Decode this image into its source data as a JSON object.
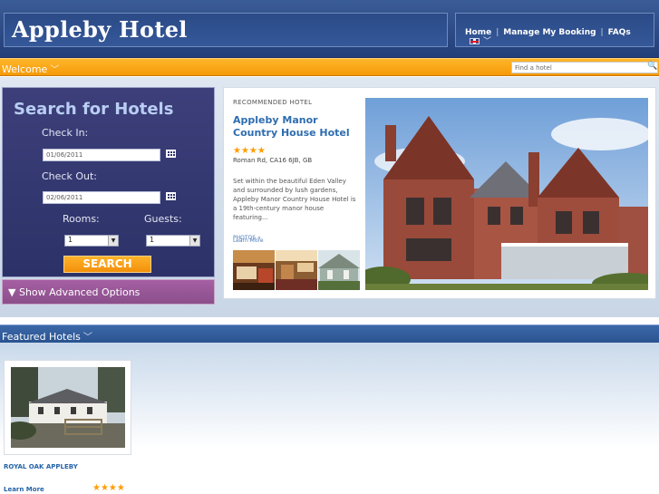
{
  "site": {
    "title": "Appleby Hotel"
  },
  "nav": {
    "links": [
      "Home",
      "Manage My Booking",
      "FAQs"
    ],
    "separator": "|",
    "language_icon": "uk-flag-icon"
  },
  "welcome": {
    "label": "Welcome",
    "find_placeholder": "Find a hotel"
  },
  "search": {
    "title": "Search for Hotels",
    "checkin_label": "Check In:",
    "checkin_value": "01/06/2011",
    "checkout_label": "Check Out:",
    "checkout_value": "02/06/2011",
    "rooms_label": "Rooms:",
    "guests_label": "Guests:",
    "rooms_value": "1",
    "guests_value": "1",
    "button_label": "SEARCH",
    "advanced_label": "▼ Show Advanced Options"
  },
  "recommended": {
    "label": "RECOMMENDED HOTEL",
    "name": "Appleby Manor Country House Hotel",
    "stars": "★★★★",
    "address": "Roman Rd, CA16 6JB, GB",
    "description": "Set within the beautiful Eden Valley and surrounded by lush gardens, Appleby Manor Country House Hotel is a 19th-century manor house featuring...",
    "photos_label": "PHOTOS »",
    "learn_more": "Learn More"
  },
  "featured": {
    "label": "Featured Hotels",
    "hotel_name": "ROYAL OAK APPLEBY",
    "learn_more": "Learn More",
    "stars": "★★★★"
  },
  "colors": {
    "header_blue": "#2c4a85",
    "orange": "#f59a08",
    "search_panel": "#2c3268",
    "advanced_purple": "#8a4f8b",
    "link_blue": "#2e6db0",
    "star_orange": "#ff9c00"
  }
}
